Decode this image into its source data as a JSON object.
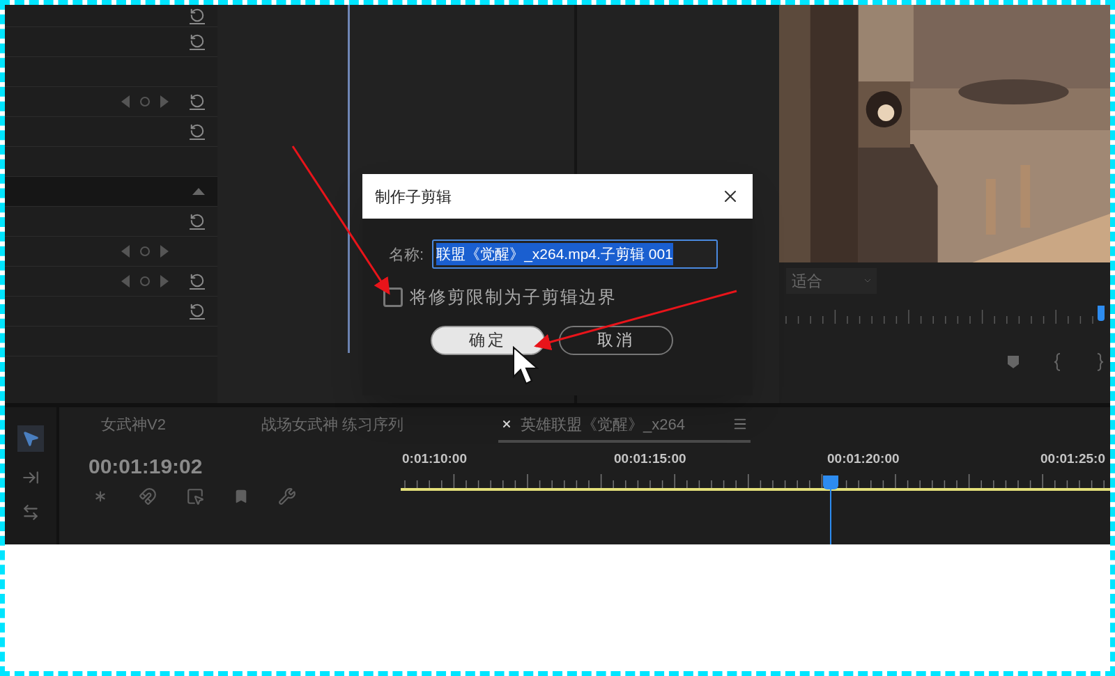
{
  "effect_rows": [
    {
      "kind": "reset"
    },
    {
      "kind": "reset"
    },
    {
      "kind": "empty"
    },
    {
      "kind": "keyframe_reset"
    },
    {
      "kind": "reset"
    },
    {
      "kind": "empty"
    },
    {
      "kind": "collapse"
    },
    {
      "kind": "reset"
    },
    {
      "kind": "keyframe"
    },
    {
      "kind": "keyframe_reset"
    },
    {
      "kind": "reset"
    },
    {
      "kind": "empty"
    }
  ],
  "dialog": {
    "title": "制作子剪辑",
    "name_label": "名称:",
    "name_value": "联盟《觉醒》_x264.mp4.子剪辑 001",
    "name_selected": true,
    "checkbox": {
      "label": "将修剪限制为子剪辑边界",
      "checked": false
    },
    "buttons": [
      {
        "label": "确定",
        "kind": "primary"
      },
      {
        "label": "取消",
        "kind": "secondary"
      }
    ]
  },
  "program_monitor": {
    "fit_label": "适合",
    "scrubber": {
      "level": 0.98
    }
  },
  "timeline": {
    "tabs": [
      {
        "label": "女武神V2",
        "selected": false,
        "closable": false
      },
      {
        "label": "战场女武神 练习序列",
        "selected": false,
        "closable": false
      },
      {
        "label": "英雄联盟《觉醒》_x264",
        "selected": true,
        "closable": true
      }
    ],
    "timecode": "00:01:19:02",
    "ruler_labels": [
      "0:01:10:00",
      "00:01:15:00",
      "00:01:20:00",
      "00:01:25:0"
    ],
    "playhead": {
      "level": 0.606
    }
  }
}
